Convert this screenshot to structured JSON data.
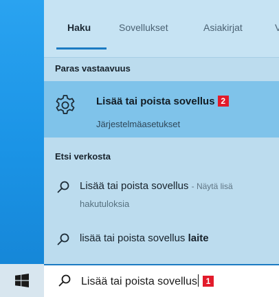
{
  "tabs": [
    {
      "label": "Haku",
      "active": true
    },
    {
      "label": "Sovellukset",
      "active": false
    },
    {
      "label": "Asiakirjat",
      "active": false
    },
    {
      "label": "V",
      "active": false
    }
  ],
  "best_match": {
    "heading": "Paras vastaavuus",
    "title": "Lisää tai poista sovellus",
    "badge": "2",
    "subtitle": "Järjestelmäasetukset",
    "icon": "gear-icon"
  },
  "web": {
    "heading": "Etsi verkosta",
    "items": [
      {
        "text": "Lisää tai poista sovellus",
        "suffix": "- Näytä lisä",
        "second_line": "hakutuloksia",
        "icon": "search-icon"
      },
      {
        "text_plain": "lisää tai poista sovellus ",
        "text_bold": "laite",
        "icon": "search-icon"
      }
    ]
  },
  "searchbox": {
    "value": "Lisää tai poista sovellus",
    "badge": "1",
    "icon": "search-icon"
  },
  "taskbar": {
    "start_icon": "windows-start-icon"
  },
  "colors": {
    "accent": "#1b7ac2",
    "badge": "#e21b2b",
    "highlight": "#7fc3ea",
    "panel": "#bcdcee"
  }
}
